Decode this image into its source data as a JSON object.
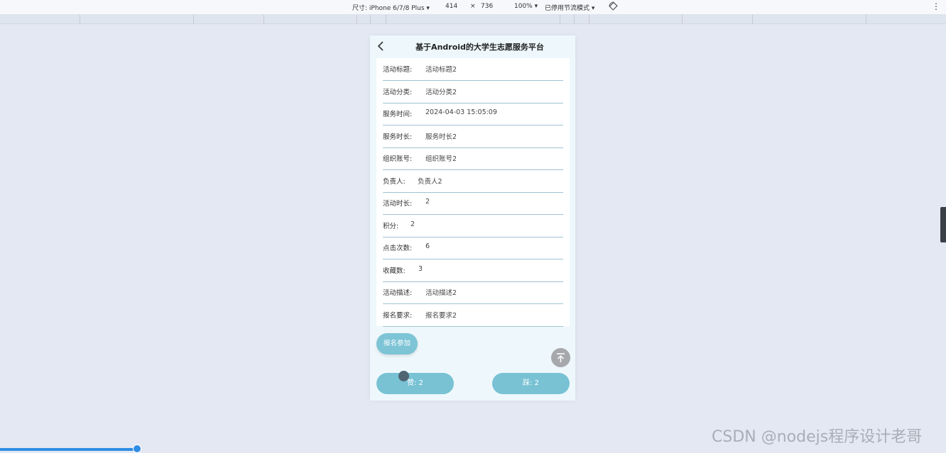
{
  "toolbar": {
    "device": "尺寸: iPhone 6/7/8 Plus ▾",
    "width": "414",
    "times": "×",
    "height": "736",
    "zoom": "100% ▾",
    "throttle": "已停用节流模式 ▾",
    "more": "⋮"
  },
  "app": {
    "title": "基于Android的大学生志愿服务平台"
  },
  "details": [
    {
      "label": "活动标题:",
      "value": "活动标题2"
    },
    {
      "label": "活动分类:",
      "value": "活动分类2"
    },
    {
      "label": "服务时间:",
      "value": "2024-04-03 15:05:09"
    },
    {
      "label": "服务时长:",
      "value": "服务时长2"
    },
    {
      "label": "组织账号:",
      "value": "组织账号2"
    },
    {
      "label": "负责人:",
      "value": "负责人2"
    },
    {
      "label": "活动时长:",
      "value": "2"
    },
    {
      "label": "积分:",
      "value": "2"
    },
    {
      "label": "点击次数:",
      "value": "6"
    },
    {
      "label": "收藏数:",
      "value": "3"
    },
    {
      "label": "活动描述:",
      "value": "活动描述2"
    },
    {
      "label": "报名要求:",
      "value": "报名要求2"
    }
  ],
  "actions": {
    "join_label": "报名参加",
    "like_label": "赞:  2",
    "dislike_label": "踩:  2"
  },
  "watermark": "CSDN @nodejs程序设计老哥",
  "colors": {
    "accent": "#78c2d4",
    "background": "#e3e8f2",
    "phone_bg": "#eef8fc"
  }
}
